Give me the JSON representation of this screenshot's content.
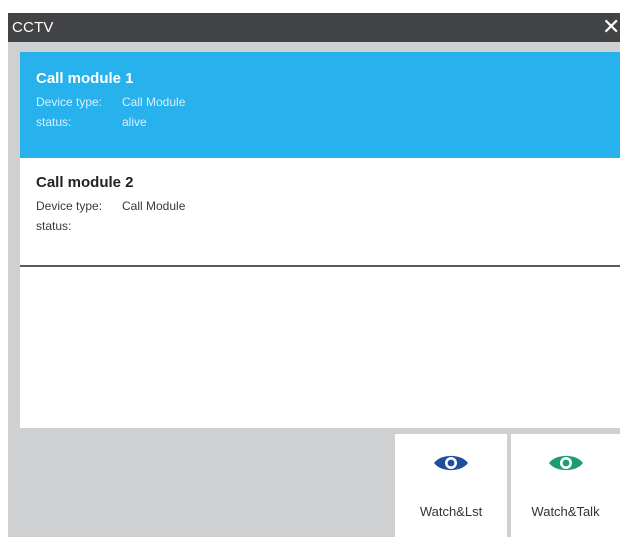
{
  "window": {
    "title": "CCTV",
    "close_icon": "close-icon"
  },
  "devices": [
    {
      "name": "Call module 1",
      "device_type_label": "Device type:",
      "device_type": "Call Module",
      "status_label": "status:",
      "status": "alive",
      "selected": true
    },
    {
      "name": "Call module 2",
      "device_type_label": "Device type:",
      "device_type": "Call Module",
      "status_label": "status:",
      "status": "",
      "selected": false
    }
  ],
  "actions": [
    {
      "label": "Watch&Lst",
      "icon": "eye-icon",
      "color": "#1f4e9a"
    },
    {
      "label": "Watch&Talk",
      "icon": "eye-icon",
      "color": "#1f9b73"
    }
  ],
  "colors": {
    "selected_bg": "#27b2ee",
    "titlebar_bg": "#424345",
    "panel_bg": "#cfd0d2"
  }
}
